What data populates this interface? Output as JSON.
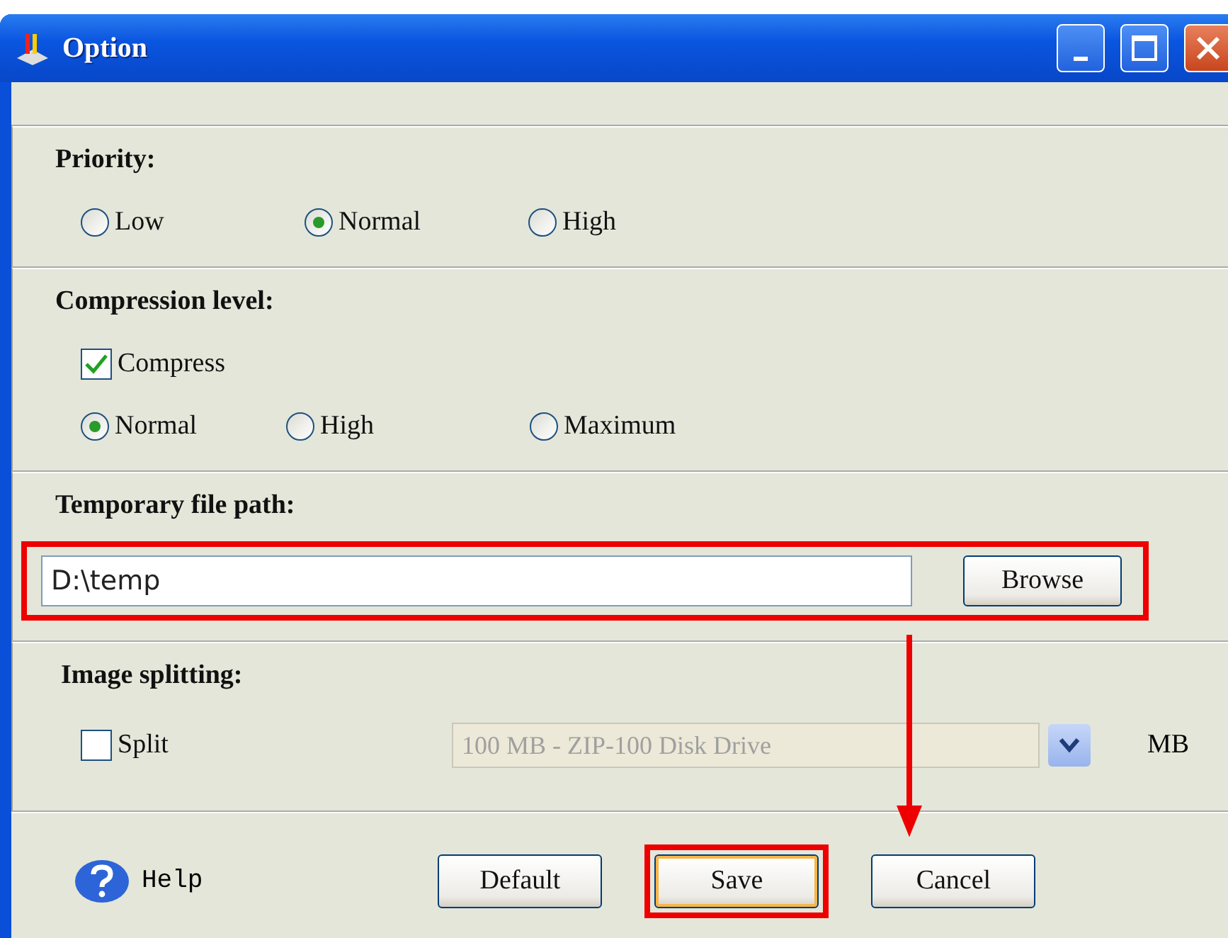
{
  "window": {
    "title": "Option"
  },
  "priority": {
    "label": "Priority:",
    "options": [
      {
        "label": "Low",
        "selected": false
      },
      {
        "label": "Normal",
        "selected": true
      },
      {
        "label": "High",
        "selected": false
      }
    ]
  },
  "compression": {
    "label": "Compression level:",
    "compress": {
      "label": "Compress",
      "checked": true
    },
    "options": [
      {
        "label": "Normal",
        "selected": true
      },
      {
        "label": "High",
        "selected": false
      },
      {
        "label": "Maximum",
        "selected": false
      }
    ]
  },
  "temp_path": {
    "label": "Temporary file path:",
    "value": "D:\\temp",
    "browse": "Browse"
  },
  "splitting": {
    "label": "Image splitting:",
    "split": {
      "label": "Split",
      "checked": false
    },
    "size": {
      "value": "100 MB - ZIP-100 Disk Drive",
      "disabled": true
    },
    "unit": "MB"
  },
  "footer": {
    "help": "Help",
    "buttons": [
      {
        "label": "Default",
        "kind": "plain"
      },
      {
        "label": "Save",
        "kind": "focused"
      },
      {
        "label": "Cancel",
        "kind": "plain"
      }
    ]
  }
}
